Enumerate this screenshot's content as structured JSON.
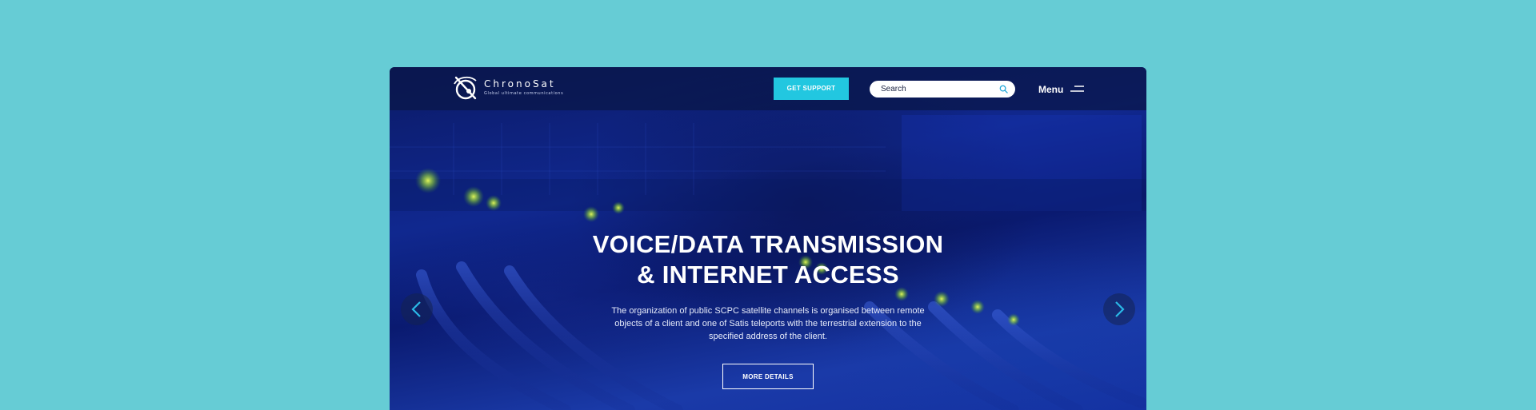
{
  "brand": {
    "name": "ChronoSat",
    "tagline": "Global ultimate communications",
    "logo_icon": "satellite-orbit-logo-icon"
  },
  "header": {
    "support_label": "GET SUPPORT",
    "search": {
      "placeholder": "Search",
      "value": "",
      "icon": "search-icon"
    },
    "menu_label": "Menu",
    "menu_icon": "hamburger-menu-icon"
  },
  "hero": {
    "title_line1": "VOICE/DATA TRANSMISSION",
    "title_line2": "& INTERNET ACCESS",
    "description": "The organization of public SCPC satellite channels is organised between remote objects of a client and one of Satis teleports with the terrestrial extension to the specified address of the client.",
    "cta_label": "MORE DETAILS",
    "prev_icon": "chevron-left-icon",
    "next_icon": "chevron-right-icon"
  },
  "colors": {
    "page_background": "#66ccd5",
    "accent": "#22c7e0",
    "hero_blue": "#10288f",
    "header_bar": "#0a1646",
    "text_light": "#ffffff"
  }
}
